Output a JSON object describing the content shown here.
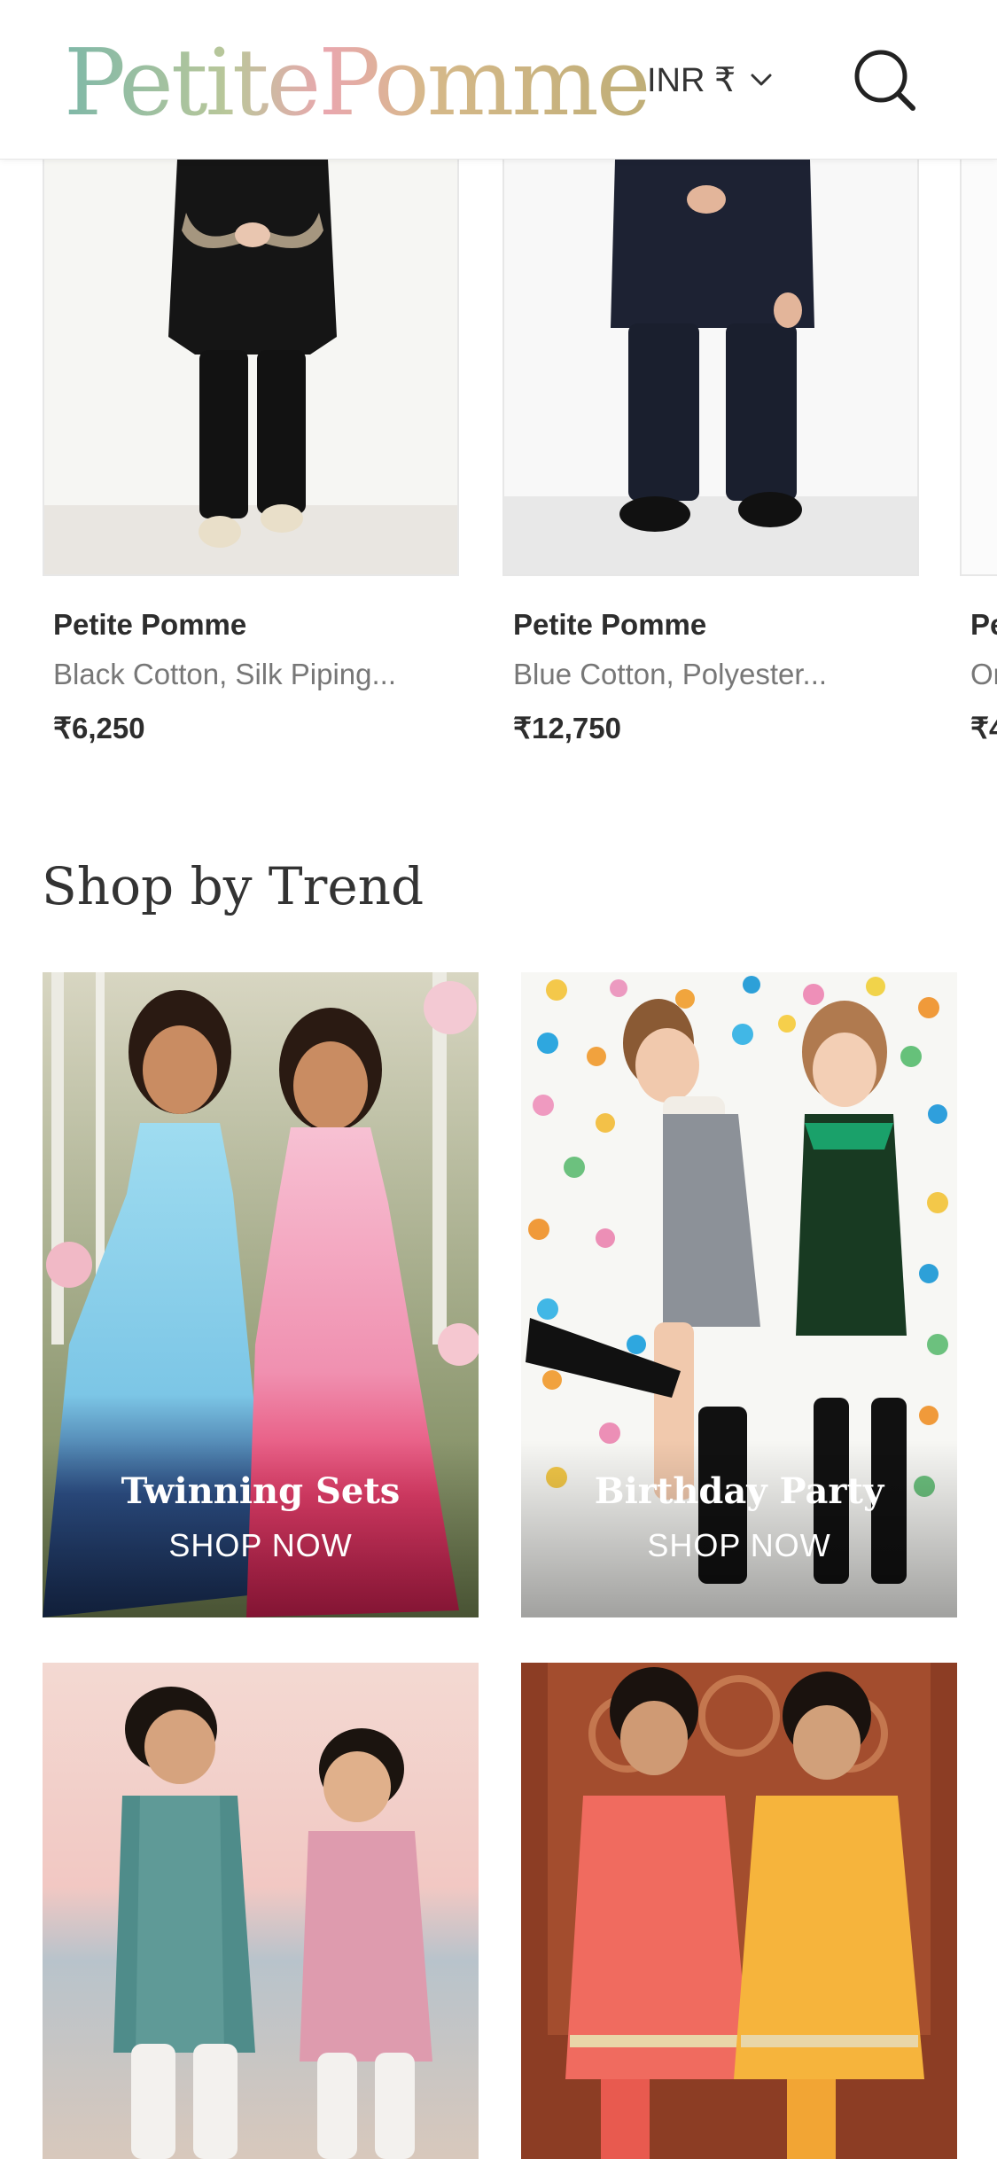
{
  "header": {
    "logo_text": "PetitePomme",
    "currency_label": "INR ₹",
    "icons": {
      "currency_dropdown": "chevron-down-icon",
      "search": "search-icon"
    }
  },
  "products": [
    {
      "brand": "Petite Pomme",
      "description": "Black Cotton, Silk Piping...",
      "price": "₹6,250"
    },
    {
      "brand": "Petite Pomme",
      "description": "Blue Cotton, Polyester...",
      "price": "₹12,750"
    },
    {
      "brand": "Pe",
      "description": "Or",
      "price": "₹4"
    }
  ],
  "trend": {
    "title": "Shop by Trend",
    "tiles": [
      {
        "title": "Twinning Sets",
        "cta": "SHOP NOW"
      },
      {
        "title": "Birthday Party",
        "cta": "SHOP NOW"
      },
      {
        "title": "",
        "cta": ""
      },
      {
        "title": "",
        "cta": ""
      }
    ]
  },
  "colors": {
    "text": "#2f2f2f",
    "muted": "#777777",
    "border": "#e7e7e7",
    "accent_logo": "#bfae77"
  }
}
